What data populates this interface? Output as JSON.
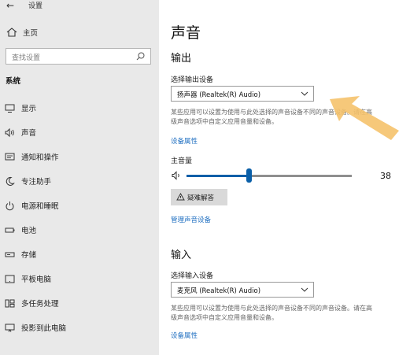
{
  "window": {
    "back_glyph": "←",
    "title": "设置"
  },
  "sidebar": {
    "home_label": "主页",
    "search_placeholder": "查找设置",
    "section_heading": "系统",
    "items": [
      {
        "label": "显示",
        "icon": "monitor-icon"
      },
      {
        "label": "声音",
        "icon": "speaker-icon"
      },
      {
        "label": "通知和操作",
        "icon": "notification-icon"
      },
      {
        "label": "专注助手",
        "icon": "moon-icon"
      },
      {
        "label": "电源和睡眠",
        "icon": "power-icon"
      },
      {
        "label": "电池",
        "icon": "battery-icon"
      },
      {
        "label": "存储",
        "icon": "storage-icon"
      },
      {
        "label": "平板电脑",
        "icon": "tablet-icon"
      },
      {
        "label": "多任务处理",
        "icon": "multitask-icon"
      },
      {
        "label": "投影到此电脑",
        "icon": "projection-icon"
      }
    ]
  },
  "main": {
    "title": "声音",
    "output": {
      "heading": "输出",
      "device_label": "选择输出设备",
      "device_value": "扬声器 (Realtek(R) Audio)",
      "desc_line1": "某些应用可以设置为使用与此处选择的声音设备不同的声音设备。请在高",
      "desc_line2": "级声音选项中自定义应用音量和设备。",
      "properties_link": "设备属性",
      "volume_label": "主音量",
      "volume_value": "38",
      "volume_fraction": 0.38,
      "troubleshoot_label": "疑难解答",
      "manage_link": "管理声音设备"
    },
    "input": {
      "heading": "输入",
      "device_label": "选择输入设备",
      "device_value": "麦克风 (Realtek(R) Audio)",
      "desc_line1": "某些应用可以设置为使用与此处选择的声音设备不同的声音设备。请在高",
      "desc_line2": "级声音选项中自定义应用音量和设备。",
      "properties_link": "设备属性"
    }
  },
  "colors": {
    "accent": "#0a5fa8",
    "link": "#1f6fc1",
    "sidebar_bg": "#e9e9e9",
    "arrow": "#f5c26b"
  }
}
